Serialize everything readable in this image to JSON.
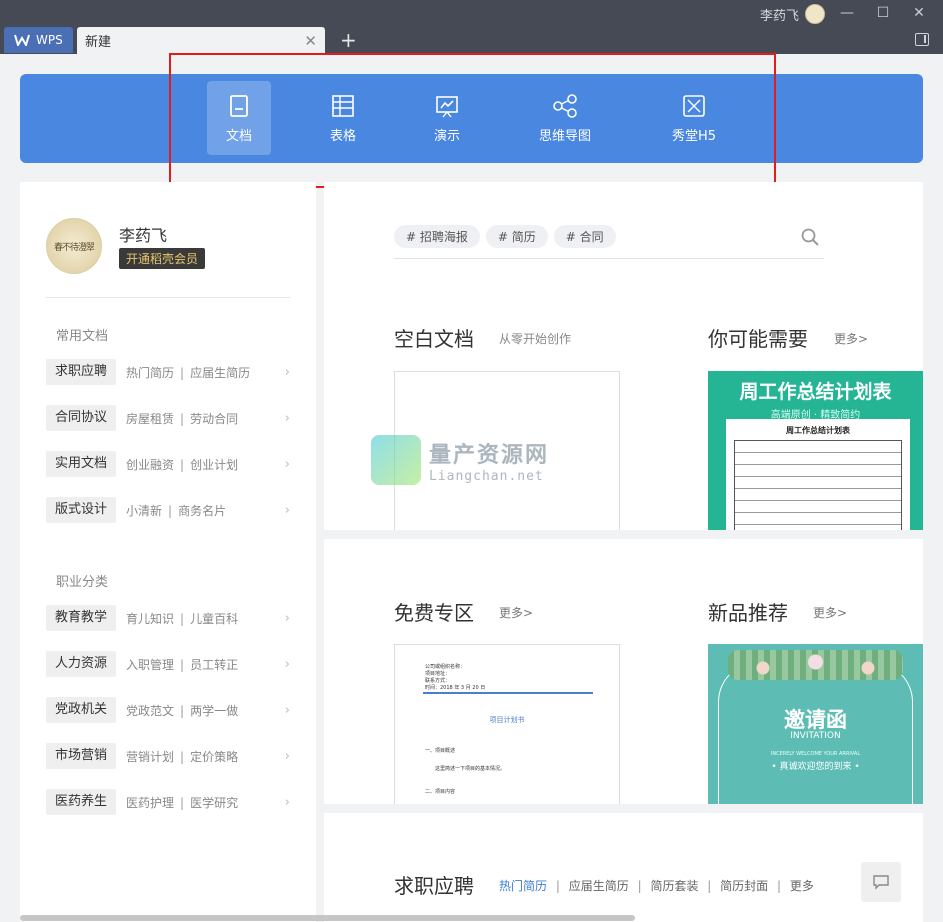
{
  "titlebar": {
    "user_name": "李药飞",
    "min": "—",
    "max": "☐",
    "close": "✕"
  },
  "tabs": [
    {
      "label": "WPS"
    },
    {
      "label": "新建"
    }
  ],
  "banner": {
    "categories": [
      {
        "label": "文档",
        "icon": "document-icon",
        "active": true
      },
      {
        "label": "表格",
        "icon": "spreadsheet-icon",
        "active": false
      },
      {
        "label": "演示",
        "icon": "presentation-icon",
        "active": false
      },
      {
        "label": "思维导图",
        "icon": "mindmap-icon",
        "active": false
      },
      {
        "label": "秀堂H5",
        "icon": "h5-icon",
        "active": false
      }
    ]
  },
  "sidebar": {
    "user_name": "李药飞",
    "vip_button": "开通稻壳会员",
    "common_title": "常用文档",
    "common": [
      {
        "tag": "求职应聘",
        "a": "热门简历",
        "b": "应届生简历"
      },
      {
        "tag": "合同协议",
        "a": "房屋租赁",
        "b": "劳动合同"
      },
      {
        "tag": "实用文档",
        "a": "创业融资",
        "b": "创业计划"
      },
      {
        "tag": "版式设计",
        "a": "小清新",
        "b": "商务名片"
      }
    ],
    "career_title": "职业分类",
    "career": [
      {
        "tag": "教育教学",
        "a": "育儿知识",
        "b": "儿童百科"
      },
      {
        "tag": "人力资源",
        "a": "入职管理",
        "b": "员工转正"
      },
      {
        "tag": "党政机关",
        "a": "党政范文",
        "b": "两学一做"
      },
      {
        "tag": "市场营销",
        "a": "营销计划",
        "b": "定价策略"
      },
      {
        "tag": "医药养生",
        "a": "医药护理",
        "b": "医学研究"
      }
    ]
  },
  "search": {
    "tags": [
      "# 招聘海报",
      "# 简历",
      "# 合同"
    ]
  },
  "sections": {
    "blank_title": "空白文档",
    "blank_sub": "从零开始创作",
    "maybe_title": "你可能需要",
    "maybe_more": "更多>",
    "free_title": "免费专区",
    "free_more": "更多>",
    "new_title": "新品推荐",
    "new_more": "更多>",
    "job_title": "求职应聘",
    "job_links": [
      "热门简历",
      "应届生简历",
      "简历套装",
      "简历封面",
      "更多"
    ]
  },
  "thumbs": {
    "weekly_title": "周工作总结计划表",
    "weekly_sub": "高端原创 · 精致简约",
    "weekly_paper_title": "周工作总结计划表",
    "doc_lines": [
      "公司或组织名称：",
      "项目地址：",
      "联系方式：",
      "时间：2018 年 3 月 20 日"
    ],
    "doc_title": "项目计划书",
    "doc_section1": "一、项目概述",
    "doc_body": "这里简述一下项目的基本情况。",
    "doc_section2": "二、项目内容",
    "invite_title": "邀请函",
    "invite_en": "INVITATION",
    "invite_small": "INCERELY WELCOME YOUR ARRIVAL",
    "invite_cn": "• 真诚欢迎您的到来 •"
  },
  "watermark": {
    "cn": "量产资源网",
    "en": "Liangchan.net"
  },
  "colors": {
    "banner": "#4a87e0",
    "highlight_box": "#e11d1d",
    "weekly_bg": "#25b494",
    "invite_bg": "#5dbdb5",
    "link_active": "#3d7bd9"
  }
}
